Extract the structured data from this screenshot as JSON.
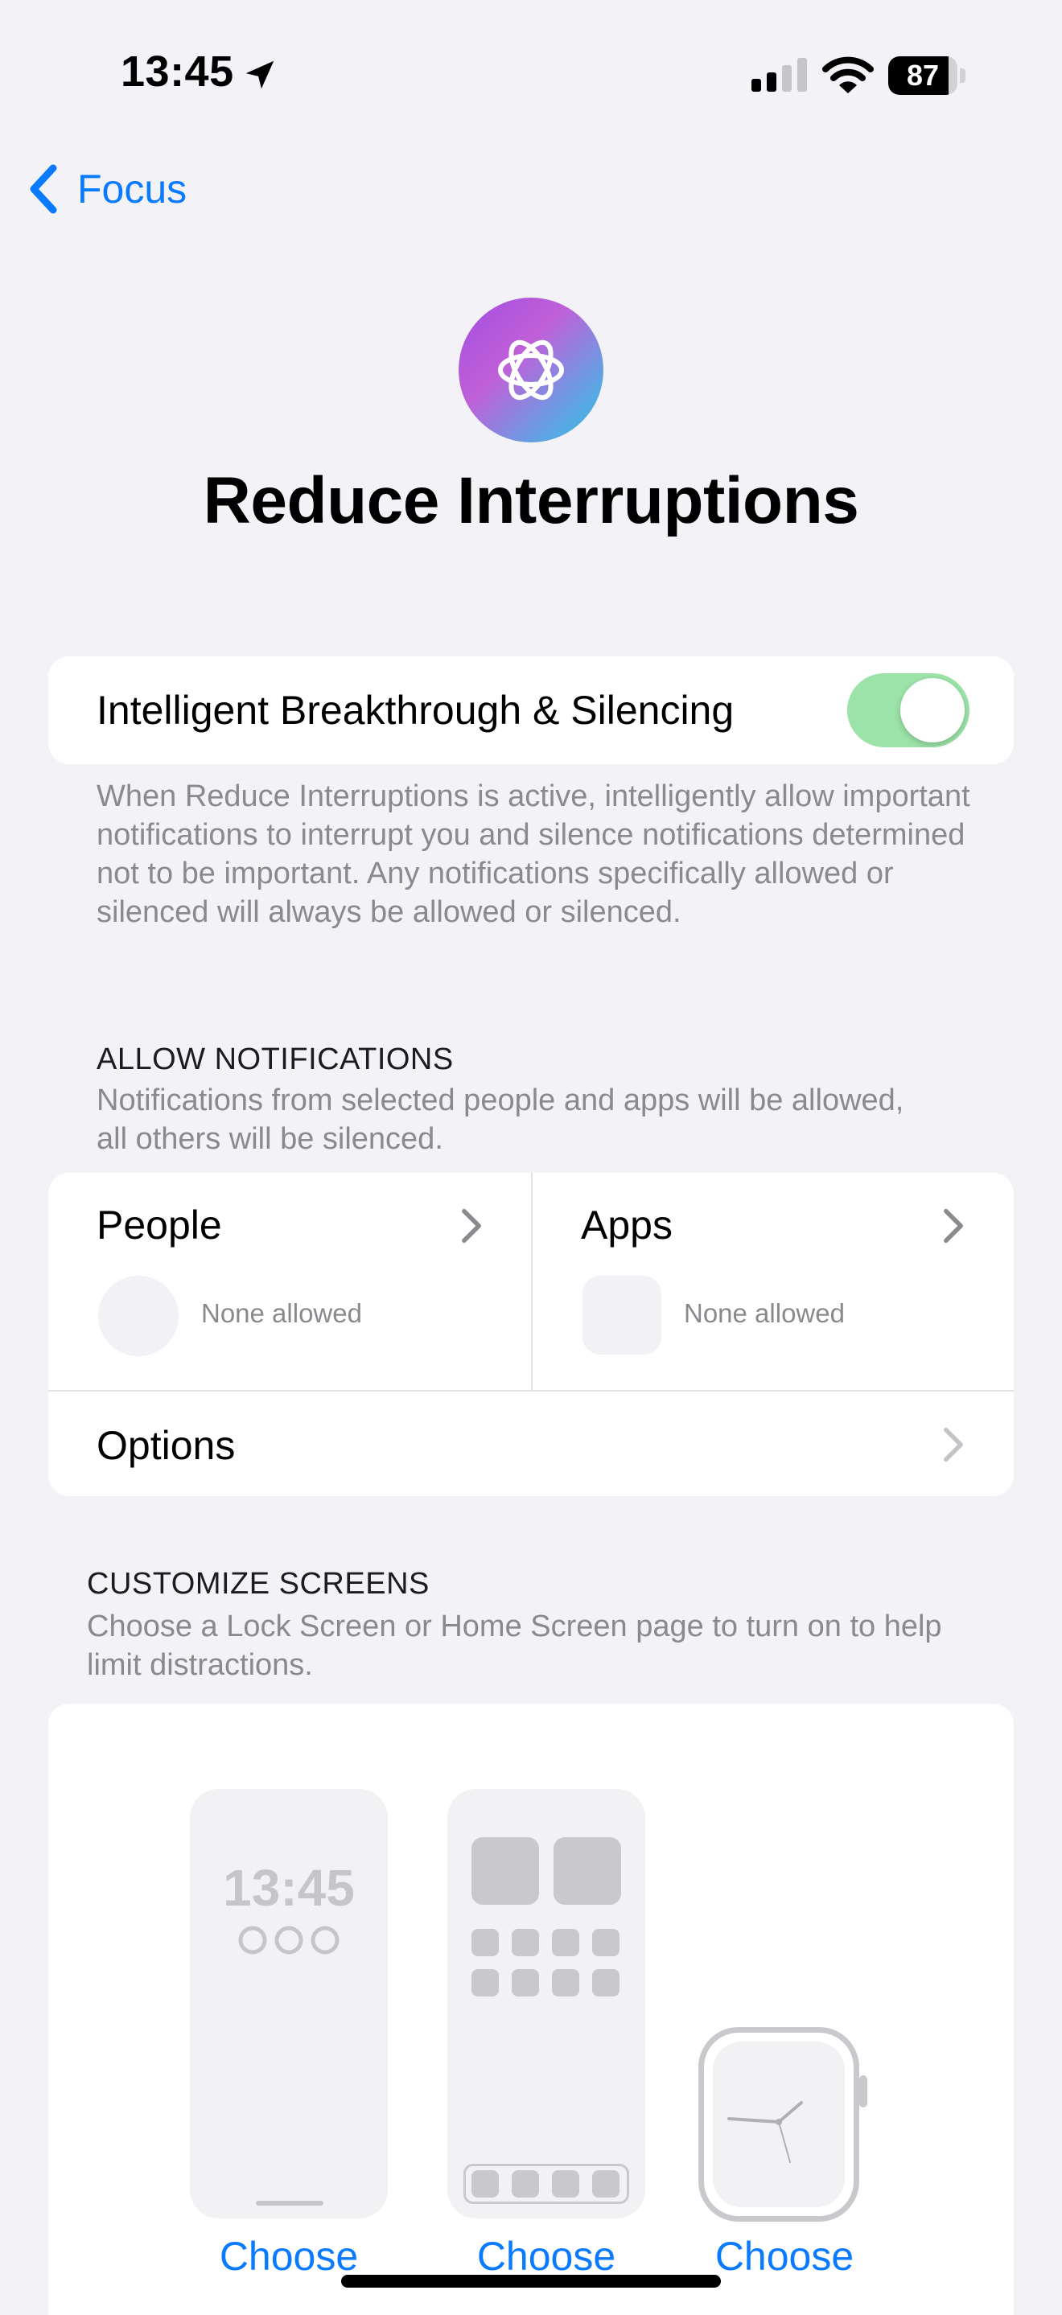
{
  "status_bar": {
    "time": "13:45",
    "battery_level": 87
  },
  "nav": {
    "back_label": "Focus"
  },
  "header": {
    "title": "Reduce Interruptions",
    "icon": "focus-reduce-interruptions-icon"
  },
  "intelligent": {
    "label": "Intelligent Breakthrough & Silencing",
    "enabled": true,
    "footer": "When Reduce Interruptions is active, intelligently allow important notifications to interrupt you and silence notifications determined not to be important. Any notifications specifically allowed or silenced will always be allowed or silenced."
  },
  "allow_notifications": {
    "header": "ALLOW NOTIFICATIONS",
    "subheader": "Notifications from selected people and apps will be allowed, all others will be silenced.",
    "people": {
      "label": "People",
      "status": "None allowed"
    },
    "apps": {
      "label": "Apps",
      "status": "None allowed"
    },
    "options_label": "Options"
  },
  "customize_screens": {
    "header": "CUSTOMIZE SCREENS",
    "subheader": "Choose a Lock Screen or Home Screen page to turn on to help limit distractions.",
    "lock_time": "13:45",
    "choose_labels": [
      "Choose",
      "Choose",
      "Choose"
    ]
  },
  "colors": {
    "accent": "#0a7aff",
    "toggle_on": "#9be3a8",
    "background": "#f2f2f7"
  }
}
